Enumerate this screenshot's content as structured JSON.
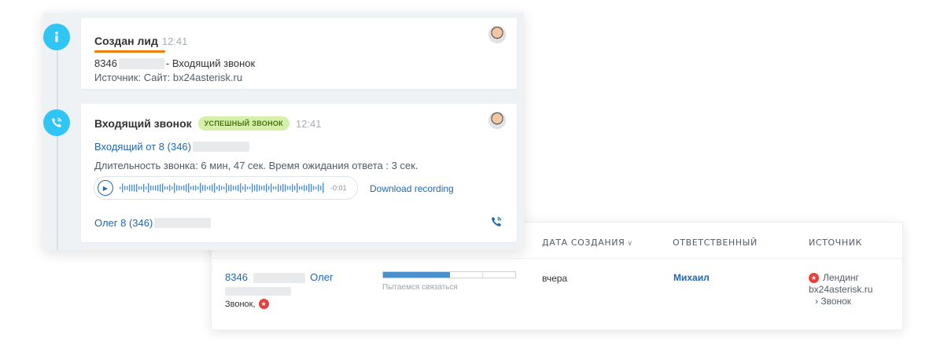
{
  "list": {
    "columns": {
      "created": "ДАТА СОЗДАНИЯ",
      "responsible": "ОТВЕТСТВЕННЫЙ",
      "source": "ИСТОЧНИК"
    },
    "row": {
      "lead_number_prefix": "8346",
      "lead_name": "Олег",
      "lead_sub": "Звонок,",
      "stage_label": "Пытаемся связаться",
      "stage_progress": 0.5,
      "created": "вчера",
      "responsible": "Михаил",
      "source_name": "Лендинг",
      "source_site": "bx24asterisk.ru",
      "source_channel": "Звонок"
    }
  },
  "timeline": {
    "lead_event": {
      "title": "Создан лид",
      "time": "12:41",
      "phone_prefix": "8346",
      "call_label": "- Входящий звонок",
      "source_line": "Источник: Сайт: bx24asterisk.ru"
    },
    "call_event": {
      "title": "Входящий звонок",
      "badge": "УСПЕШНЫЙ ЗВОНОК",
      "time": "12:41",
      "incoming_prefix": "Входящий от 8 (346)",
      "duration_text": "Длительность звонка: 6 мин, 47 сек. Время ожидания ответа : 3 сек.",
      "player_time": "-0:01",
      "download_label": "Download recording",
      "contact_prefix": "Олег 8 (346)"
    }
  },
  "colors": {
    "accent_blue": "#2067b0",
    "timeline_icon": "#2fc6f6",
    "badge_bg": "#d5f0a8",
    "underline_orange": "#f07e0b",
    "source_red": "#e5403a"
  },
  "icons": {
    "info": "info-icon",
    "phone": "phone-icon",
    "play": "play-icon",
    "chevron": "chevron-down-icon",
    "star": "star-icon"
  }
}
